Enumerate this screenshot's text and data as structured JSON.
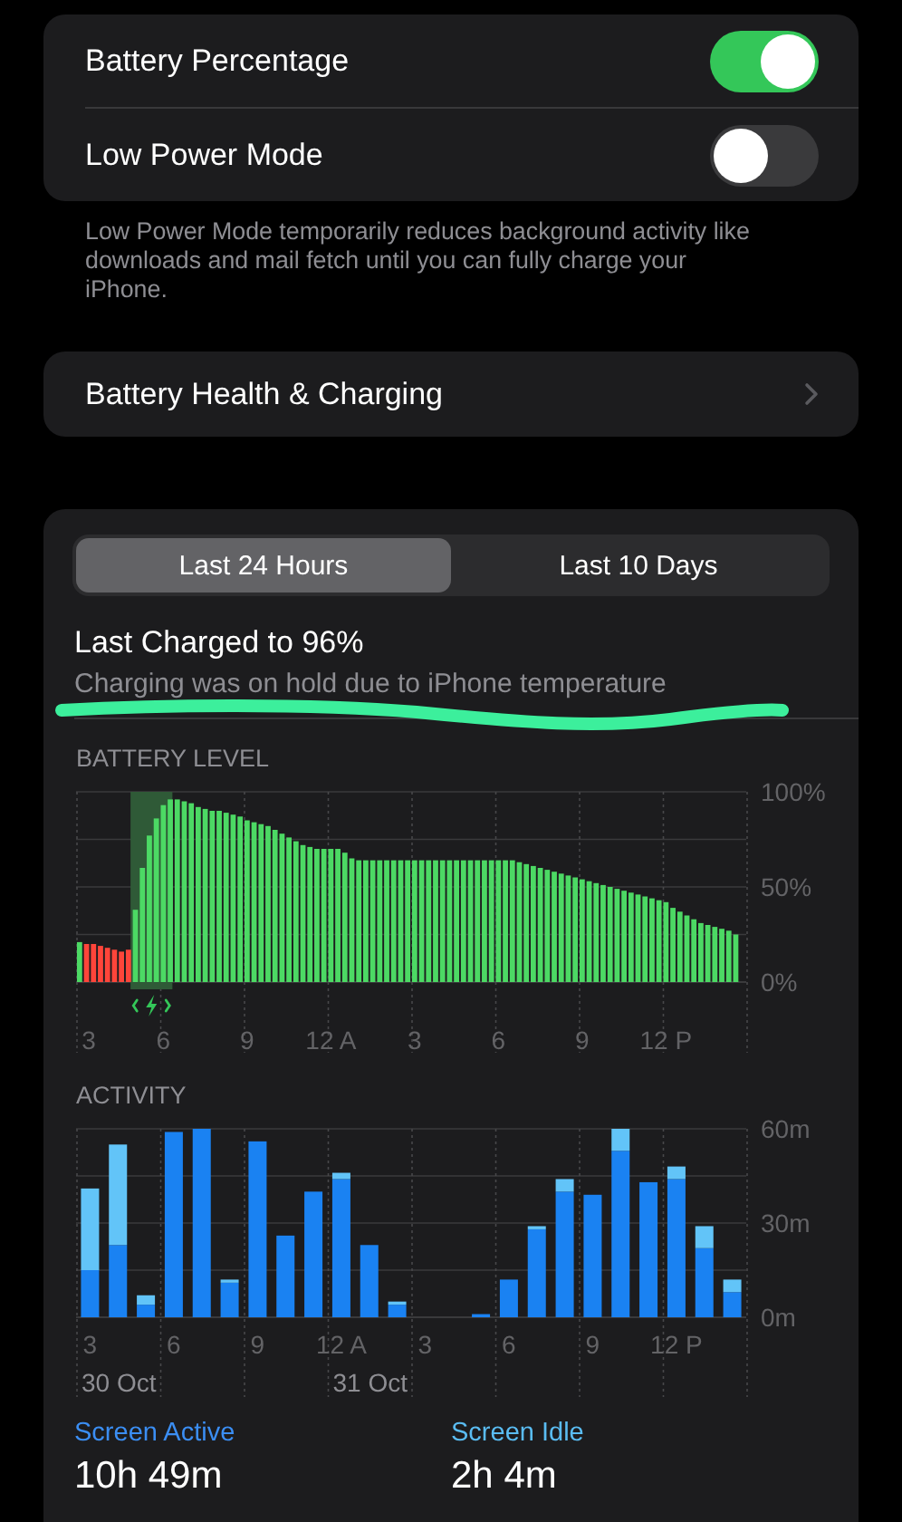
{
  "settings": [
    {
      "kind": "toggle",
      "label": "Battery Percentage",
      "on": true
    },
    {
      "kind": "toggle",
      "label": "Low Power Mode",
      "on": false
    }
  ],
  "settings_footer": "Low Power Mode temporarily reduces background activity like downloads and mail fetch until you can fully charge your iPhone.",
  "battery_health": {
    "label": "Battery Health & Charging"
  },
  "range_tabs": [
    {
      "label": "Last 24 Hours",
      "selected": true
    },
    {
      "label": "Last 10 Days",
      "selected": false
    }
  ],
  "last_charged": {
    "title": "Last Charged to 96%",
    "subtitle": "Charging was on hold due to iPhone temperature"
  },
  "battery_level": {
    "chart_data": {
      "type": "bar",
      "title": "BATTERY LEVEL",
      "ylim": [
        0,
        100
      ],
      "categories": [
        "3",
        null,
        null,
        null,
        null,
        null,
        null,
        null,
        null,
        null,
        null,
        null,
        "6",
        null,
        null,
        null,
        null,
        null,
        null,
        null,
        null,
        null,
        null,
        null,
        "9",
        null,
        null,
        null,
        null,
        null,
        null,
        null,
        null,
        null,
        null,
        null,
        "12 A",
        null,
        null,
        null,
        null,
        null,
        null,
        null,
        null,
        null,
        null,
        null,
        "3",
        null,
        null,
        null,
        null,
        null,
        null,
        null,
        null,
        null,
        null,
        null,
        "6",
        null,
        null,
        null,
        null,
        null,
        null,
        null,
        null,
        null,
        null,
        null,
        "9",
        null,
        null,
        null,
        null,
        null,
        null,
        null,
        null,
        null,
        null,
        null,
        "12 P",
        null,
        null,
        null,
        null,
        null,
        null,
        null,
        null,
        null,
        null,
        null
      ],
      "series": [
        {
          "color": "#4cd964",
          "values": [
            21,
            null,
            null,
            null,
            null,
            null,
            null,
            null,
            38,
            60,
            77,
            86,
            93,
            96,
            96,
            95,
            94,
            92,
            91,
            90,
            90,
            89,
            88,
            87,
            85,
            84,
            83,
            82,
            80,
            78,
            76,
            74,
            72,
            71,
            70,
            70,
            70,
            70,
            68,
            65,
            64,
            64,
            64,
            64,
            64,
            64,
            64,
            64,
            64,
            64,
            64,
            64,
            64,
            64,
            64,
            64,
            64,
            64,
            64,
            64,
            64,
            64,
            64,
            63,
            62,
            61,
            60,
            59,
            58,
            57,
            56,
            55,
            54,
            53,
            52,
            51,
            50,
            49,
            48,
            47,
            46,
            45,
            44,
            43,
            42,
            39,
            37,
            35,
            33,
            31,
            30,
            29,
            28,
            27,
            25,
            null
          ]
        },
        {
          "color": "#ff453a",
          "values": [
            null,
            20,
            20,
            19,
            18,
            17,
            16,
            17,
            null,
            null,
            null,
            null,
            null,
            null,
            null,
            null,
            null,
            null,
            null,
            null,
            null,
            null,
            null,
            null,
            null,
            null,
            null,
            null,
            null,
            null,
            null,
            null,
            null,
            null,
            null,
            null,
            null,
            null,
            null,
            null,
            null,
            null,
            null,
            null,
            null,
            null,
            null,
            null,
            null,
            null,
            null,
            null,
            null,
            null,
            null,
            null,
            null,
            null,
            null,
            null,
            null,
            null,
            null,
            null,
            null,
            null,
            null,
            null,
            null,
            null,
            null,
            null,
            null,
            null,
            null,
            null,
            null,
            null,
            null,
            null,
            null,
            null,
            null,
            null,
            null,
            null,
            null,
            null,
            null,
            null,
            null,
            null,
            null,
            null,
            null,
            null
          ]
        }
      ],
      "yticks": [
        {
          "value": 0,
          "label": "0%"
        },
        {
          "value": 50,
          "label": "50%"
        },
        {
          "value": 100,
          "label": "100%"
        }
      ]
    }
  },
  "activity": {
    "dates": [
      "30 Oct",
      "31 Oct"
    ],
    "chart_data": {
      "type": "bar",
      "title": "ACTIVITY",
      "ylim": [
        0,
        60
      ],
      "stacked": true,
      "categories": [
        "3",
        null,
        null,
        "6",
        null,
        null,
        "9",
        null,
        null,
        "12 A",
        null,
        null,
        "3",
        null,
        null,
        "6",
        null,
        null,
        "9",
        null,
        null,
        "12 P",
        null,
        null
      ],
      "series": [
        {
          "name": "Screen Active",
          "color": "#1a82f2",
          "values": [
            15,
            23,
            4,
            59,
            60,
            11,
            56,
            26,
            40,
            44,
            23,
            4,
            0,
            0,
            1,
            12,
            28,
            40,
            39,
            53,
            43,
            44,
            22,
            8
          ]
        },
        {
          "name": "Screen Idle",
          "color": "#62c4f8",
          "values": [
            26,
            32,
            3,
            0,
            0,
            1,
            0,
            0,
            0,
            2,
            0,
            1,
            0,
            0,
            0,
            0,
            1,
            4,
            0,
            7,
            0,
            4,
            7,
            4
          ]
        }
      ],
      "yticks": [
        {
          "value": 0,
          "label": "0m"
        },
        {
          "value": 30,
          "label": "30m"
        },
        {
          "value": 60,
          "label": "60m"
        }
      ]
    }
  },
  "usage": [
    {
      "value": "10h 49m",
      "color": "#3b8ef3"
    },
    {
      "value": "2h 4m",
      "color": "#5abcf2"
    }
  ]
}
